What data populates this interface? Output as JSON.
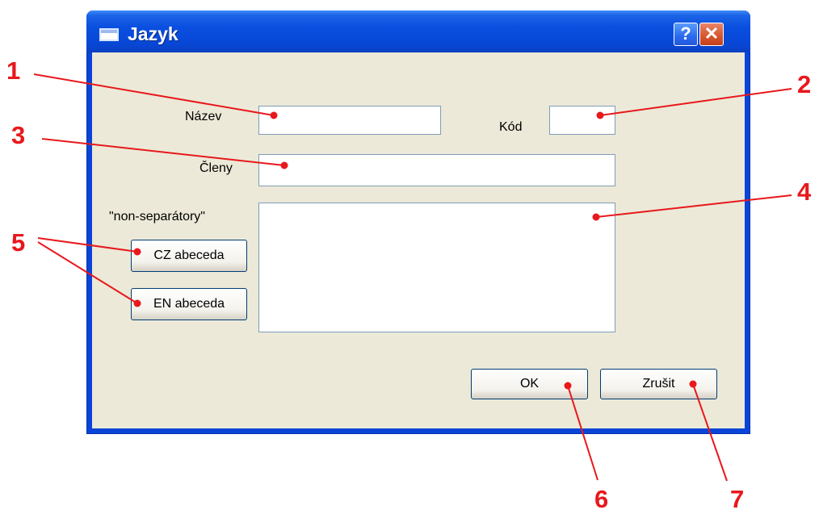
{
  "window": {
    "title": "Jazyk",
    "help_label": "?",
    "close_label": "✕"
  },
  "form": {
    "nazev_label": "Název",
    "nazev_value": "",
    "kod_label": "Kód",
    "kod_value": "",
    "cleny_label": "Členy",
    "cleny_value": "",
    "nonsep_label": "\"non-separátory\"",
    "nonsep_value": "",
    "cz_button": "CZ abeceda",
    "en_button": "EN abeceda",
    "ok_button": "OK",
    "cancel_button": "Zrušit"
  },
  "callouts": [
    "1",
    "2",
    "3",
    "4",
    "5",
    "6",
    "7"
  ],
  "colors": {
    "callout": "#e8181c",
    "dialog_bg": "#ece9d8",
    "titlebar": "#0a4fe0"
  }
}
